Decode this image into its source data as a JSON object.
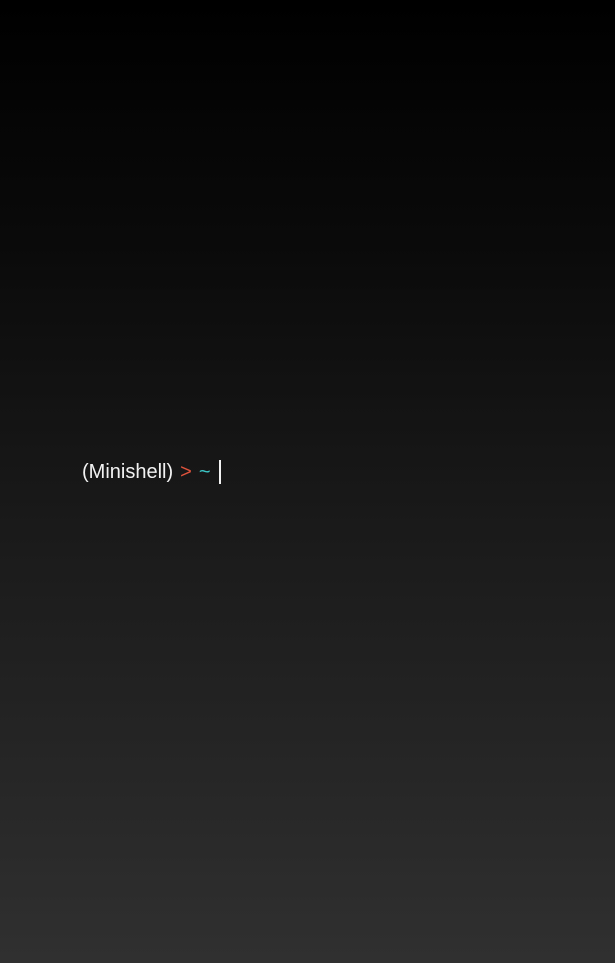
{
  "terminal": {
    "shell_name": "(Minishell)",
    "prompt_symbol": ">",
    "cwd": "~",
    "input_value": ""
  },
  "colors": {
    "prompt_symbol": "#e0533c",
    "cwd": "#3cc8c8",
    "text": "#f2f2f2"
  }
}
